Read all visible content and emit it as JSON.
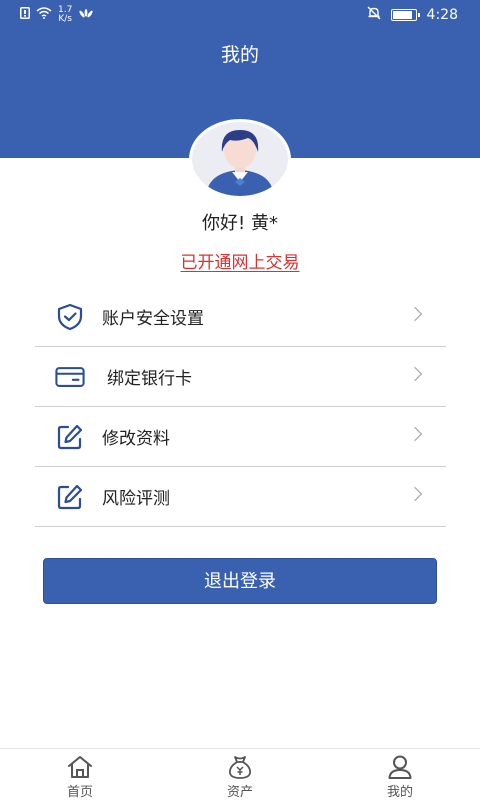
{
  "status_bar": {
    "net_speed_value": "1.7",
    "net_speed_unit": "K/s",
    "time": "4:28",
    "battery_level": 0.85
  },
  "header": {
    "title": "我的"
  },
  "profile": {
    "greeting": "你好! 黄*",
    "trade_status": "已开通网上交易"
  },
  "menu": {
    "items": [
      {
        "label": "账户安全设置",
        "icon": "shield-check-icon"
      },
      {
        "label": "绑定银行卡",
        "icon": "bank-card-icon"
      },
      {
        "label": "修改资料",
        "icon": "edit-icon"
      },
      {
        "label": "风险评测",
        "icon": "edit-icon"
      }
    ]
  },
  "logout": {
    "label": "退出登录"
  },
  "tabbar": {
    "tabs": [
      {
        "label": "首页",
        "icon": "home-icon"
      },
      {
        "label": "资产",
        "icon": "money-bag-icon"
      },
      {
        "label": "我的",
        "icon": "user-icon"
      }
    ]
  },
  "colors": {
    "primary": "#3a60b0",
    "link_red": "#e02f2f",
    "divider": "#cfcfcf"
  }
}
